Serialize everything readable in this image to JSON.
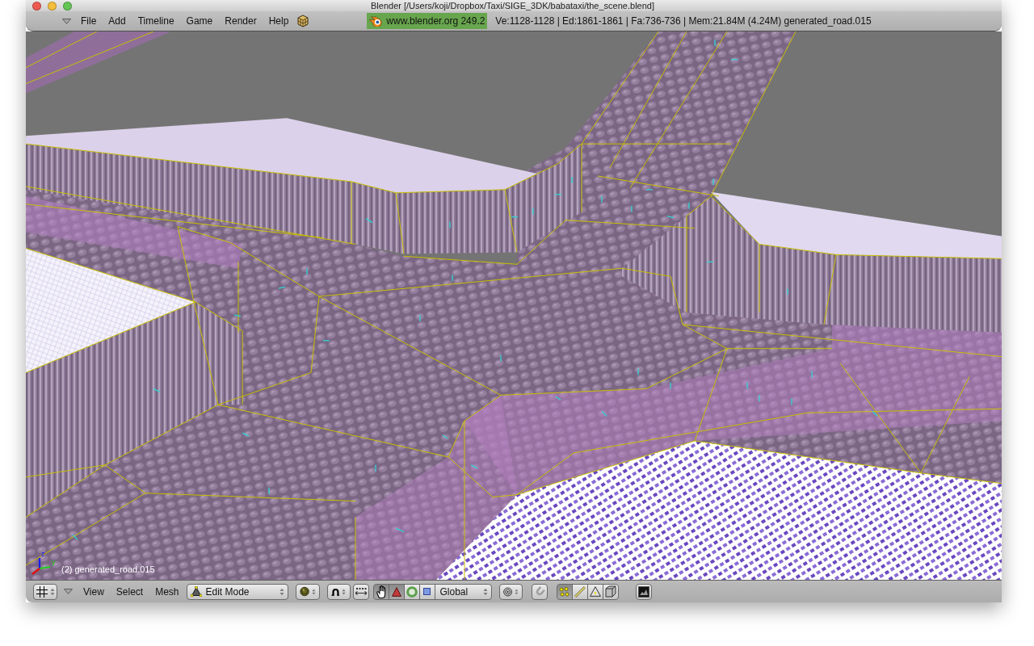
{
  "window": {
    "title": "Blender [/Users/koji/Dropbox/Taxi/SIGE_3DK/babataxi/the_scene.blend]"
  },
  "info_header": {
    "menus": [
      "File",
      "Add",
      "Timeline",
      "Game",
      "Render",
      "Help"
    ],
    "version_badge": "www.blender.org 249.2",
    "stats": "Ve:1128-1128 | Ed:1861-1861 | Fa:736-736 | Mem:21.84M (4.24M) generated_road.015"
  },
  "viewport": {
    "object_label": "(2) generated_road.015",
    "axis_labels": [
      "z",
      "y"
    ]
  },
  "view3d_header": {
    "menus": [
      "View",
      "Select",
      "Mesh"
    ],
    "mode": "Edit Mode",
    "manipulators": [
      {
        "kind": "hand",
        "selected": true
      },
      {
        "kind": "translate",
        "selected": true
      },
      {
        "kind": "rotate",
        "selected": false
      },
      {
        "kind": "scale",
        "selected": false
      }
    ],
    "orientation": "Global",
    "snap": {
      "on": false
    },
    "select_modes": [
      {
        "kind": "vertex",
        "selected": true
      },
      {
        "kind": "edge",
        "selected": false
      },
      {
        "kind": "face",
        "selected": false
      }
    ],
    "occlude_background": {
      "on": false
    }
  }
}
